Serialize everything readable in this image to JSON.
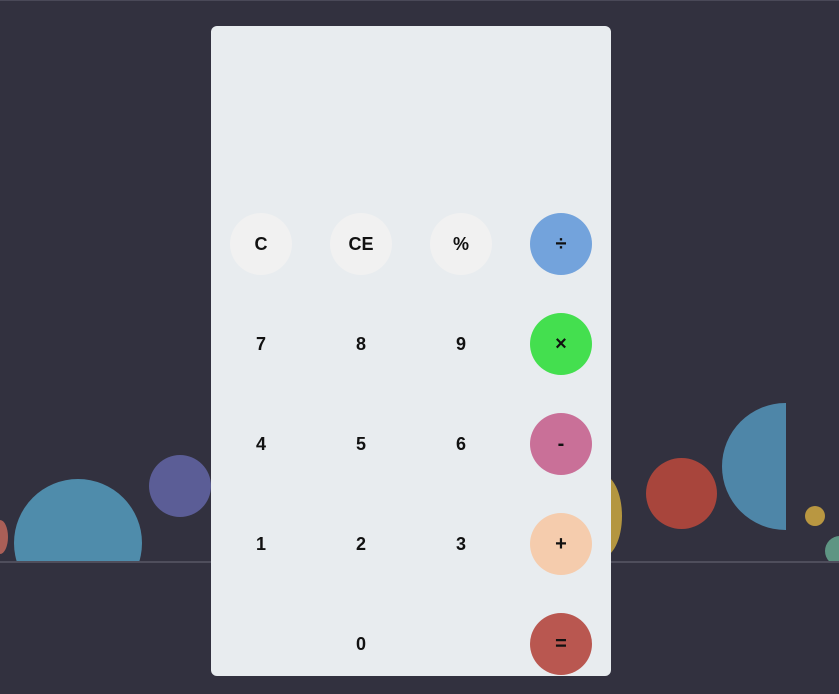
{
  "display": {
    "value": ""
  },
  "colors": {
    "page_background": "#32313f",
    "calculator_background": "#e8ecef",
    "function_key_background": "#f1f1f1",
    "divide": "#73a3dc",
    "multiply": "#44df4f",
    "subtract": "#c97098",
    "add": "#f5ccad",
    "equals": "#b95750"
  },
  "keys": {
    "clear": "C",
    "clear_entry": "CE",
    "percent": "%",
    "divide": "÷",
    "seven": "7",
    "eight": "8",
    "nine": "9",
    "multiply": "×",
    "four": "4",
    "five": "5",
    "six": "6",
    "subtract": "-",
    "one": "1",
    "two": "2",
    "three": "3",
    "add": "+",
    "zero": "0",
    "equals": "="
  }
}
